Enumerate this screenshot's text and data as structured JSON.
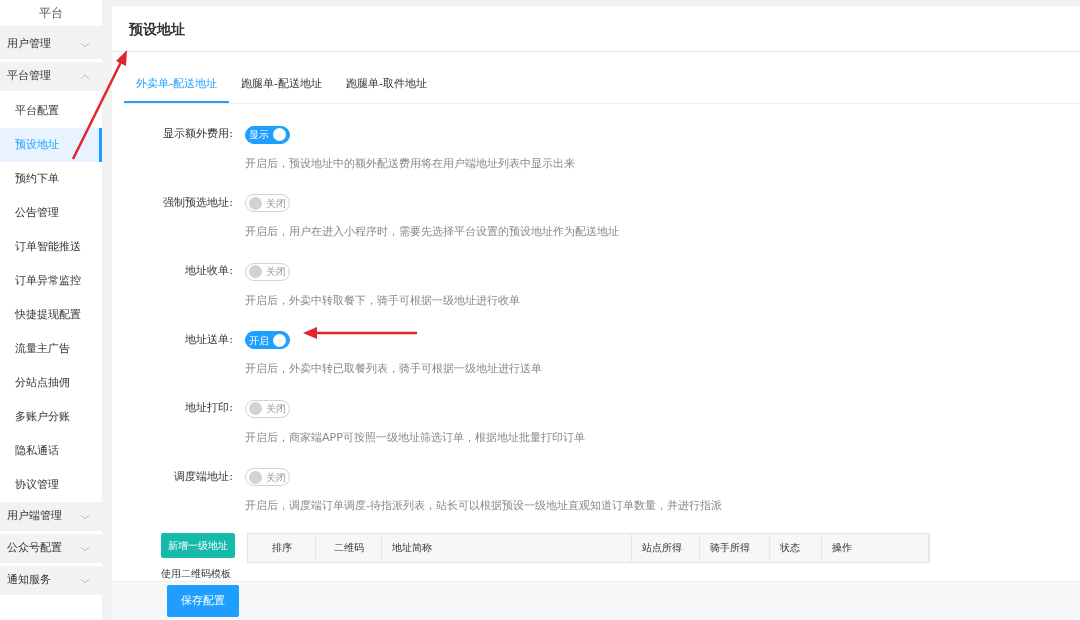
{
  "sidebar": {
    "header": "平台",
    "groups": [
      {
        "label": "用户管理",
        "expanded": false
      },
      {
        "label": "平台管理",
        "expanded": true,
        "children": [
          {
            "label": "平台配置",
            "selected": false
          },
          {
            "label": "预设地址",
            "selected": true
          },
          {
            "label": "预约下单",
            "selected": false
          },
          {
            "label": "公告管理",
            "selected": false
          },
          {
            "label": "订单智能推送",
            "selected": false
          },
          {
            "label": "订单异常监控",
            "selected": false
          },
          {
            "label": "快捷提现配置",
            "selected": false
          },
          {
            "label": "流量主广告",
            "selected": false
          },
          {
            "label": "分站点抽佣",
            "selected": false
          },
          {
            "label": "多账户分账",
            "selected": false
          },
          {
            "label": "隐私通话",
            "selected": false
          },
          {
            "label": "协议管理",
            "selected": false
          }
        ]
      },
      {
        "label": "用户端管理",
        "expanded": false
      },
      {
        "label": "公众号配置",
        "expanded": false
      },
      {
        "label": "通知服务",
        "expanded": false
      }
    ]
  },
  "page_title": "预设地址",
  "tabs": [
    {
      "label": "外卖单-配送地址",
      "selected": true
    },
    {
      "label": "跑腿单-配送地址",
      "selected": false
    },
    {
      "label": "跑腿单-取件地址",
      "selected": false
    }
  ],
  "settings": [
    {
      "label": "显示额外费用:",
      "on": true,
      "switch_text": "显示",
      "description": "开启后，预设地址中的额外配送费用将在用户端地址列表中显示出来"
    },
    {
      "label": "强制预选地址:",
      "on": false,
      "switch_text": "关闭",
      "description": "开启后，用户在进入小程序时，需要先选择平台设置的预设地址作为配送地址"
    },
    {
      "label": "地址收单:",
      "on": false,
      "switch_text": "关闭",
      "description": "开启后，外卖中转取餐下，骑手可根据一级地址进行收单"
    },
    {
      "label": "地址送单:",
      "on": true,
      "switch_text": "开启",
      "description": "开启后，外卖中转已取餐列表，骑手可根据一级地址进行送单"
    },
    {
      "label": "地址打印:",
      "on": false,
      "switch_text": "关闭",
      "description": "开启后，商家端APP可按照一级地址筛选订单，根据地址批量打印订单"
    },
    {
      "label": "调度端地址:",
      "on": false,
      "switch_text": "关闭",
      "description": "开启后，调度端订单调度-待指派列表，站长可以根据预设一级地址直观知道订单数量，并进行指派"
    }
  ],
  "add_button": "新增一级地址",
  "template_label": "使用二维码模板",
  "table": {
    "columns": [
      "排序",
      "二维码",
      "地址简称",
      "站点所得",
      "骑手所得",
      "状态",
      "操作"
    ]
  },
  "save_button": "保存配置"
}
